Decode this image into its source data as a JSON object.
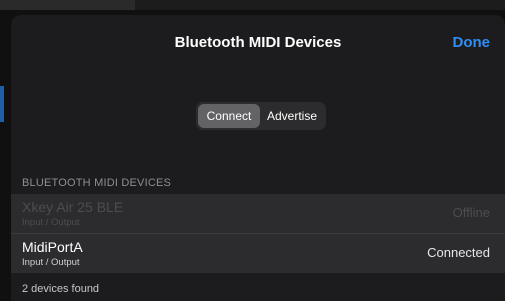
{
  "sheet": {
    "title": "Bluetooth MIDI Devices",
    "done_label": "Done"
  },
  "segmented_control": {
    "segments": [
      "Connect",
      "Advertise"
    ],
    "selected": "Connect"
  },
  "devices_section": {
    "header": "BLUETOOTH MIDI DEVICES",
    "devices": [
      {
        "name": "Xkey Air 25 BLE",
        "ports": "Input / Output",
        "status": "Offline"
      },
      {
        "name": "MidiPortA",
        "ports": "Input / Output",
        "status": "Connected"
      }
    ],
    "footer": "2 devices found"
  },
  "colors": {
    "accent": "#2f8ef4",
    "sheet_background": "#1c1c1e",
    "row_background": "#2c2c2e"
  }
}
